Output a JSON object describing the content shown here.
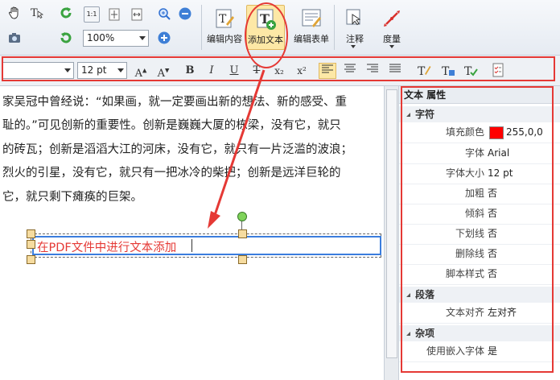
{
  "ribbon": {
    "zoom_value": "100%",
    "edit_content_label": "编辑内容",
    "add_text_label": "添加文本",
    "edit_form_label": "编辑表单",
    "comment_label": "注释",
    "measure_label": "度量",
    "actual_size_glyph": "1:1"
  },
  "format": {
    "font_value": "",
    "size_value": "12 pt",
    "bold": "B",
    "italic": "I",
    "underline": "U",
    "strike": "T",
    "subscript": "x₂",
    "superscript": "x²"
  },
  "document": {
    "lines": [
      "家吴冠中曾经说：“如果画，就一定要画出新的想法、新的感受、重",
      "耻的。”可见创新的重要性。创新是巍巍大厦的栋梁，没有它，就只",
      "的砖瓦；创新是滔滔大江的河床，没有它，就只有一片泛滥的波浪；",
      "烈火的引星，没有它，就只有一把冰冷的柴把；创新是远洋巨轮的",
      "它，就只剩下瘫痪的巨架。"
    ],
    "added_text": "在PDF文件中进行文本添加"
  },
  "panel": {
    "title": "文本 属性",
    "section_char": "字符",
    "section_para": "段落",
    "section_misc": "杂项",
    "fill_color_label": "填充颜色",
    "fill_color_value": "255,0,0",
    "font_label": "字体",
    "font_value": "Arial",
    "size_label": "字体大小",
    "size_value": "12 pt",
    "bold_label": "加粗",
    "bold_value": "否",
    "italic_label": "倾斜",
    "italic_value": "否",
    "underline_label": "下划线",
    "underline_value": "否",
    "strike_label": "删除线",
    "strike_value": "否",
    "script_label": "脚本样式",
    "script_value": "否",
    "align_label": "文本对齐",
    "align_value": "左对齐",
    "embed_label": "使用嵌入字体",
    "embed_value": "是"
  },
  "colors": {
    "annotation_red": "#e53935",
    "fill_swatch": "#ff0000",
    "active": "#fde8a6"
  }
}
